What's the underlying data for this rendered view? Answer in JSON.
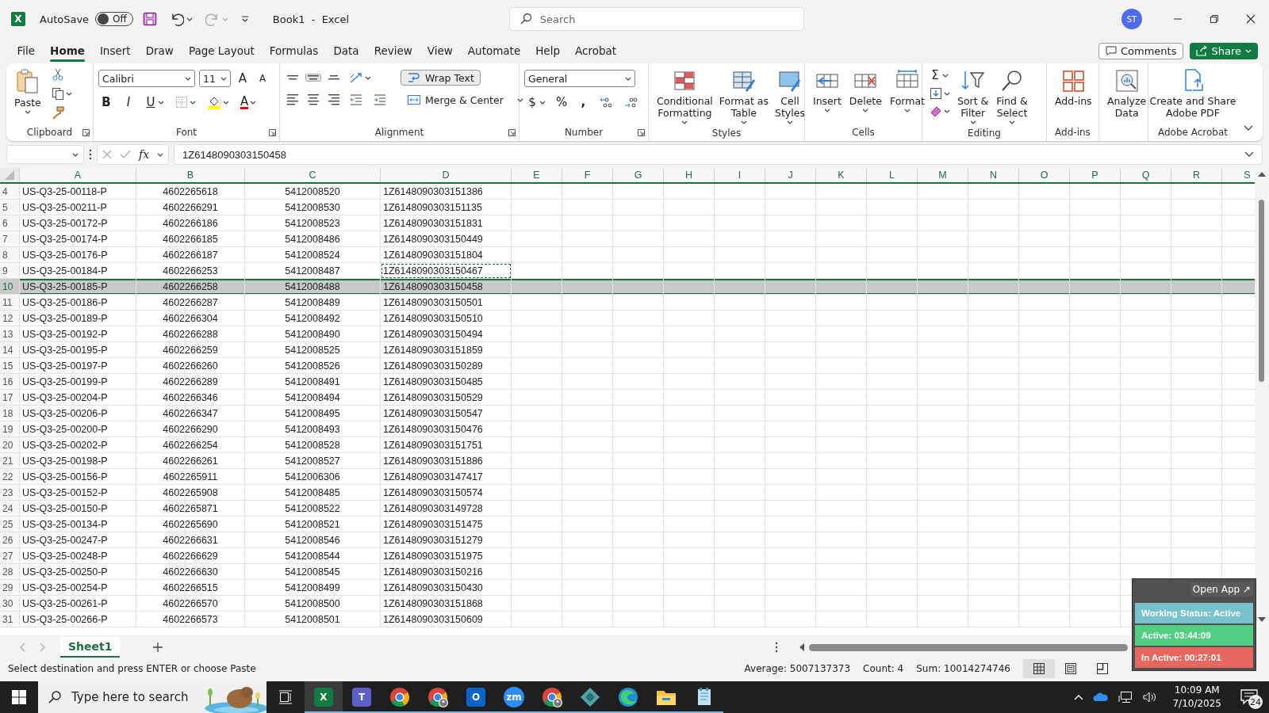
{
  "titlebar": {
    "logo": "X",
    "autosave_label": "AutoSave",
    "autosave": {
      "label": "Off",
      "on": false
    },
    "title": "Book1  -  Excel",
    "search_placeholder": "Search",
    "avatar": "ST"
  },
  "menu": [
    {
      "label": "File",
      "selected": false
    },
    {
      "label": "Home",
      "selected": true
    },
    {
      "label": "Insert",
      "selected": false
    },
    {
      "label": "Draw",
      "selected": false
    },
    {
      "label": "Page Layout",
      "selected": false
    },
    {
      "label": "Formulas",
      "selected": false
    },
    {
      "label": "Data",
      "selected": false
    },
    {
      "label": "Review",
      "selected": false
    },
    {
      "label": "View",
      "selected": false
    },
    {
      "label": "Automate",
      "selected": false
    },
    {
      "label": "Help",
      "selected": false
    },
    {
      "label": "Acrobat",
      "selected": false
    }
  ],
  "comments": "Comments",
  "share": "Share",
  "ribbon": {
    "clipboard": {
      "label": "Clipboard",
      "paste": {
        "lines": [
          "Paste"
        ],
        "dropdown": true
      }
    },
    "font": {
      "label": "Font",
      "family": "Calibri",
      "size": "11",
      "grow": "A",
      "shrink": "A",
      "bold": "B",
      "italic": "I",
      "underline": "U",
      "font_color": "A"
    },
    "alignment": {
      "label": "Alignment",
      "middle_align_selected": true,
      "wrap_text": {
        "label": "Wrap Text",
        "selected": true
      },
      "merge": "Merge & Center"
    },
    "number": {
      "label": "Number",
      "format": "General",
      "currency": "$",
      "percent": "%",
      "comma": ","
    },
    "styles": {
      "label": "Styles",
      "buttons": [
        {
          "lines": [
            "Conditional",
            "Formatting"
          ],
          "dropdown": true
        },
        {
          "lines": [
            "Format as",
            "Table"
          ],
          "dropdown": true
        },
        {
          "lines": [
            "Cell",
            "Styles"
          ],
          "dropdown": true
        }
      ]
    },
    "cells": {
      "label": "Cells",
      "buttons": [
        {
          "lines": [
            "Insert"
          ],
          "dropdown": true
        },
        {
          "lines": [
            "Delete"
          ],
          "dropdown": true
        },
        {
          "lines": [
            "Format"
          ],
          "dropdown": true
        }
      ]
    },
    "editing": {
      "label": "Editing",
      "autosum": "Σ",
      "buttons": [
        {
          "lines": [
            "Sort &",
            "Filter"
          ],
          "dropdown": true
        },
        {
          "lines": [
            "Find &",
            "Select"
          ],
          "dropdown": true
        }
      ]
    },
    "addins": {
      "label": "Add-ins",
      "buttons": [
        {
          "lines": [
            "Add-ins"
          ],
          "dropdown": false
        }
      ]
    },
    "analyze": {
      "buttons": [
        {
          "lines": [
            "Analyze",
            "Data"
          ],
          "dropdown": false
        }
      ]
    },
    "acrobat": {
      "label": "Adobe Acrobat",
      "buttons": [
        {
          "lines": [
            "Create and Share",
            "Adobe PDF"
          ],
          "dropdown": false
        }
      ]
    }
  },
  "formula_bar": {
    "fx": "fx",
    "value": "1Z6148090303150458"
  },
  "columns": [
    "A",
    "B",
    "C",
    "D",
    "E",
    "F",
    "G",
    "H",
    "I",
    "J",
    "K",
    "L",
    "M",
    "N",
    "O",
    "P",
    "Q",
    "R",
    "S"
  ],
  "rows": [
    {
      "number": "4",
      "cells": [
        "US-Q3-25-00118-P",
        "4602265618",
        "5412008520",
        "1Z6148090303151386"
      ],
      "selected": false,
      "copied": false
    },
    {
      "number": "5",
      "cells": [
        "US-Q3-25-00211-P",
        "4602266291",
        "5412008530",
        "1Z6148090303151135"
      ],
      "selected": false,
      "copied": false
    },
    {
      "number": "6",
      "cells": [
        "US-Q3-25-00172-P",
        "4602266186",
        "5412008523",
        "1Z6148090303151831"
      ],
      "selected": false,
      "copied": false
    },
    {
      "number": "7",
      "cells": [
        "US-Q3-25-00174-P",
        "4602266185",
        "5412008486",
        "1Z6148090303150449"
      ],
      "selected": false,
      "copied": false
    },
    {
      "number": "8",
      "cells": [
        "US-Q3-25-00176-P",
        "4602266187",
        "5412008524",
        "1Z6148090303151804"
      ],
      "selected": false,
      "copied": false
    },
    {
      "number": "9",
      "cells": [
        "US-Q3-25-00184-P",
        "4602266253",
        "5412008487",
        "1Z6148090303150467"
      ],
      "selected": false,
      "copied": true
    },
    {
      "number": "10",
      "cells": [
        "US-Q3-25-00185-P",
        "4602266258",
        "5412008488",
        "1Z6148090303150458"
      ],
      "selected": true,
      "copied": false
    },
    {
      "number": "11",
      "cells": [
        "US-Q3-25-00186-P",
        "4602266287",
        "5412008489",
        "1Z6148090303150501"
      ],
      "selected": false,
      "copied": false
    },
    {
      "number": "12",
      "cells": [
        "US-Q3-25-00189-P",
        "4602266304",
        "5412008492",
        "1Z6148090303150510"
      ],
      "selected": false,
      "copied": false
    },
    {
      "number": "13",
      "cells": [
        "US-Q3-25-00192-P",
        "4602266288",
        "5412008490",
        "1Z6148090303150494"
      ],
      "selected": false,
      "copied": false
    },
    {
      "number": "14",
      "cells": [
        "US-Q3-25-00195-P",
        "4602266259",
        "5412008525",
        "1Z6148090303151859"
      ],
      "selected": false,
      "copied": false
    },
    {
      "number": "15",
      "cells": [
        "US-Q3-25-00197-P",
        "4602266260",
        "5412008526",
        "1Z6148090303150289"
      ],
      "selected": false,
      "copied": false
    },
    {
      "number": "16",
      "cells": [
        "US-Q3-25-00199-P",
        "4602266289",
        "5412008491",
        "1Z6148090303150485"
      ],
      "selected": false,
      "copied": false
    },
    {
      "number": "17",
      "cells": [
        "US-Q3-25-00204-P",
        "4602266346",
        "5412008494",
        "1Z6148090303150529"
      ],
      "selected": false,
      "copied": false
    },
    {
      "number": "18",
      "cells": [
        "US-Q3-25-00206-P",
        "4602266347",
        "5412008495",
        "1Z6148090303150547"
      ],
      "selected": false,
      "copied": false
    },
    {
      "number": "19",
      "cells": [
        "US-Q3-25-00200-P",
        "4602266290",
        "5412008493",
        "1Z6148090303150476"
      ],
      "selected": false,
      "copied": false
    },
    {
      "number": "20",
      "cells": [
        "US-Q3-25-00202-P",
        "4602266254",
        "5412008528",
        "1Z6148090303151751"
      ],
      "selected": false,
      "copied": false
    },
    {
      "number": "21",
      "cells": [
        "US-Q3-25-00198-P",
        "4602266261",
        "5412008527",
        "1Z6148090303151886"
      ],
      "selected": false,
      "copied": false
    },
    {
      "number": "22",
      "cells": [
        "US-Q3-25-00156-P",
        "4602265911",
        "5412006306",
        "1Z6148090303147417"
      ],
      "selected": false,
      "copied": false
    },
    {
      "number": "23",
      "cells": [
        "US-Q3-25-00152-P",
        "4602265908",
        "5412008485",
        "1Z6148090303150574"
      ],
      "selected": false,
      "copied": false
    },
    {
      "number": "24",
      "cells": [
        "US-Q3-25-00150-P",
        "4602265871",
        "5412008522",
        "1Z6148090303149728"
      ],
      "selected": false,
      "copied": false
    },
    {
      "number": "25",
      "cells": [
        "US-Q3-25-00134-P",
        "4602265690",
        "5412008521",
        "1Z6148090303151475"
      ],
      "selected": false,
      "copied": false
    },
    {
      "number": "26",
      "cells": [
        "US-Q3-25-00247-P",
        "4602266631",
        "5412008546",
        "1Z6148090303151279"
      ],
      "selected": false,
      "copied": false
    },
    {
      "number": "27",
      "cells": [
        "US-Q3-25-00248-P",
        "4602266629",
        "5412008544",
        "1Z6148090303151975"
      ],
      "selected": false,
      "copied": false
    },
    {
      "number": "28",
      "cells": [
        "US-Q3-25-00250-P",
        "4602266630",
        "5412008545",
        "1Z6148090303150216"
      ],
      "selected": false,
      "copied": false
    },
    {
      "number": "29",
      "cells": [
        "US-Q3-25-00254-P",
        "4602266515",
        "5412008499",
        "1Z6148090303150430"
      ],
      "selected": false,
      "copied": false
    },
    {
      "number": "30",
      "cells": [
        "US-Q3-25-00261-P",
        "4602266570",
        "5412008500",
        "1Z6148090303151868"
      ],
      "selected": false,
      "copied": false
    },
    {
      "number": "31",
      "cells": [
        "US-Q3-25-00266-P",
        "4602266573",
        "5412008501",
        "1Z6148090303150609"
      ],
      "selected": false,
      "copied": false
    }
  ],
  "sheets": [
    {
      "label": "Sheet1",
      "selected": true
    }
  ],
  "status_bar": {
    "message": "Select destination and press ENTER or choose Paste",
    "stats": [
      "Average: 5007137373",
      "Count: 4",
      "Sum: 10014274746"
    ],
    "views": [
      {
        "kind": "normal",
        "selected": true
      },
      {
        "kind": "page_layout",
        "selected": false
      },
      {
        "kind": "page_break",
        "selected": false
      }
    ]
  },
  "widget": {
    "open_app": "Open App ↗",
    "statuses": [
      {
        "label": "Working Status: Active",
        "color": "#78c2cc"
      },
      {
        "label": "Active: 03:44:09",
        "color": "#4fcf7f"
      },
      {
        "label": "In Active: 00:27:01",
        "color": "#e8685f"
      }
    ]
  },
  "taskbar": {
    "search_placeholder": "Type here to search",
    "apps": [
      {
        "kind": "excel",
        "glyph": "X",
        "selected": true
      },
      {
        "kind": "teams",
        "glyph": "T",
        "selected": false
      },
      {
        "kind": "chrome",
        "selected": false
      },
      {
        "kind": "chrome_profile",
        "selected": false
      },
      {
        "kind": "outlook",
        "glyph": "O",
        "selected": false
      },
      {
        "kind": "zoom",
        "glyph": "zm",
        "selected": false
      },
      {
        "kind": "chrome_profile",
        "selected": false
      },
      {
        "kind": "diamond",
        "selected": false
      },
      {
        "kind": "edge",
        "selected": false
      },
      {
        "kind": "folder",
        "selected": false
      },
      {
        "kind": "notepad",
        "selected": false
      }
    ],
    "time": "10:09 AM",
    "date": "7/10/2025",
    "notifications": "24"
  }
}
